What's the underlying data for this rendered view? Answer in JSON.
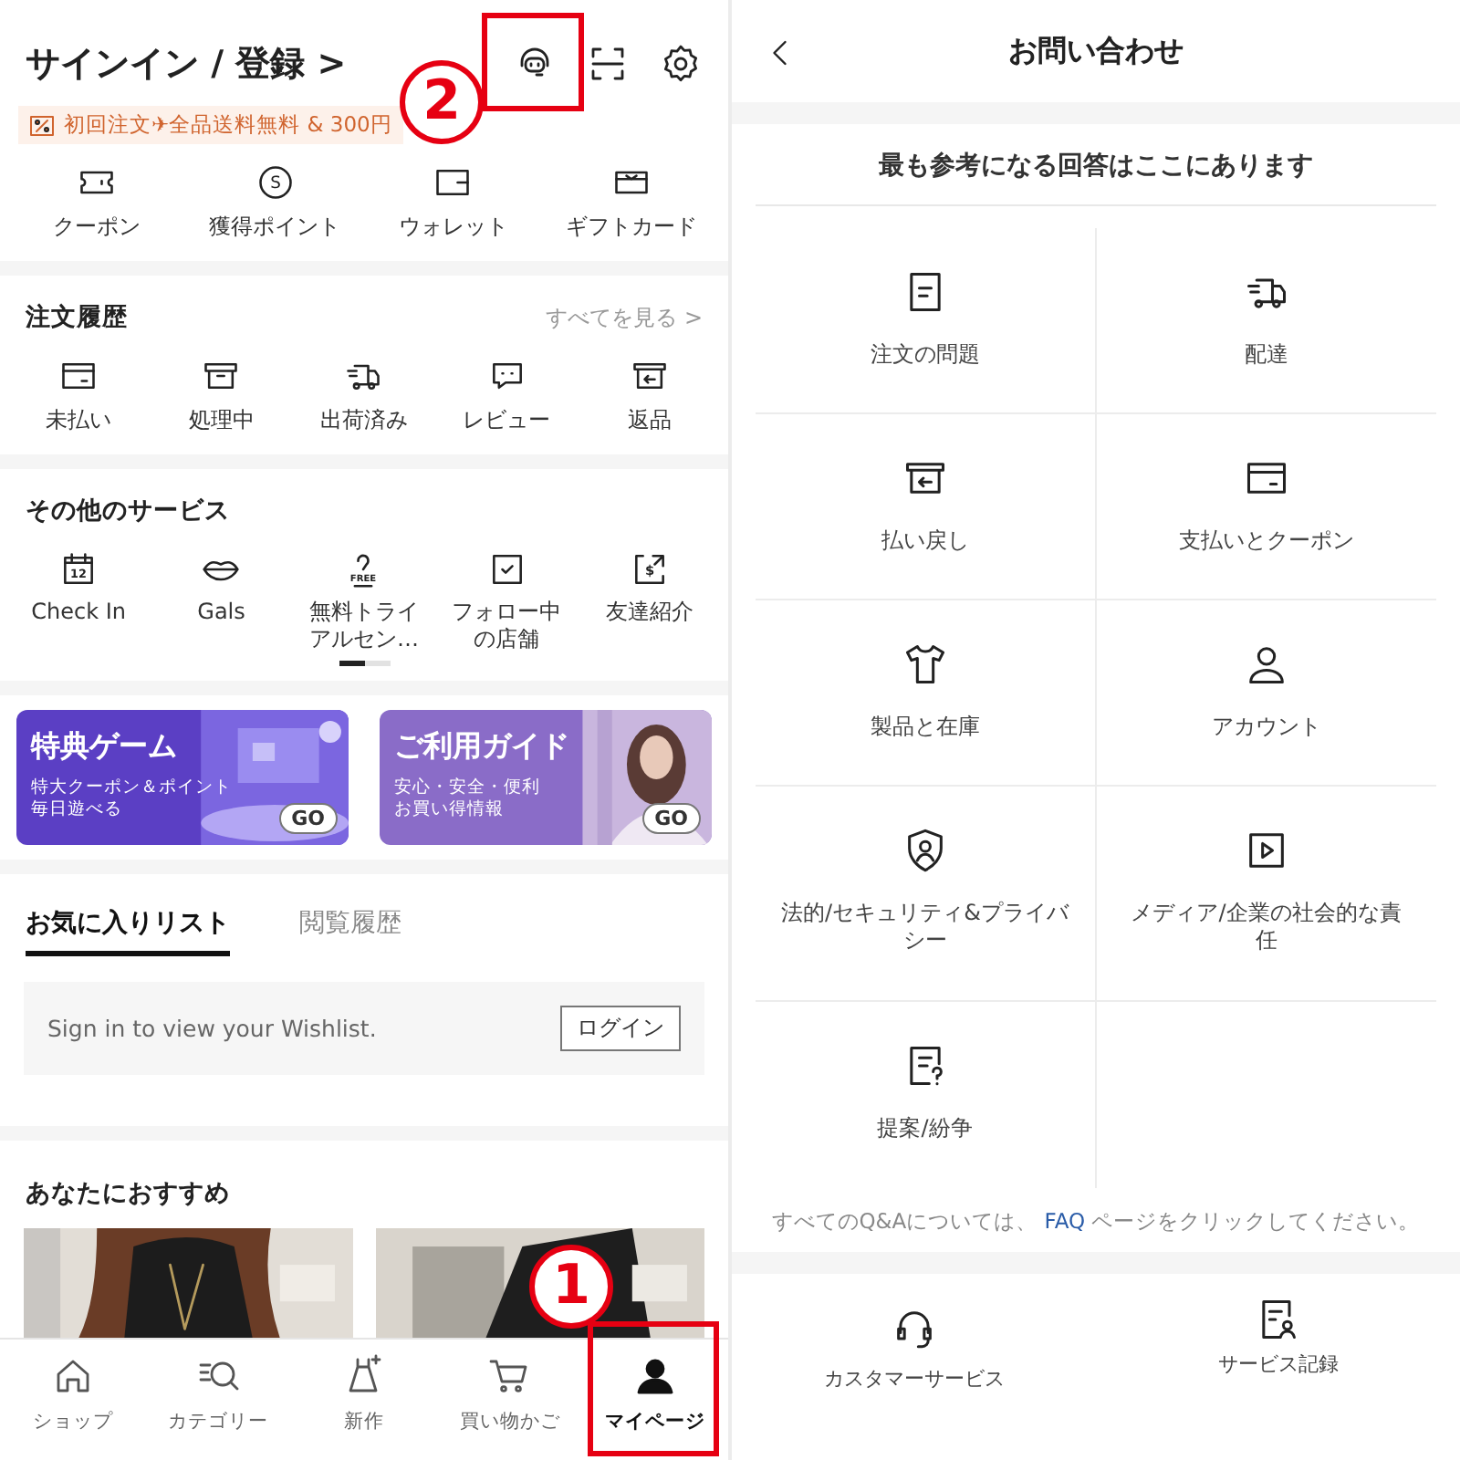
{
  "account": {
    "title": "サインイン / 登録 >",
    "promo": "初回注文✈全品送料無料 & 300円",
    "wallet": [
      {
        "label": "クーポン"
      },
      {
        "label": "獲得ポイント",
        "icon_text": "S"
      },
      {
        "label": "ウォレット"
      },
      {
        "label": "ギフトカード"
      }
    ],
    "orders": {
      "title": "注文履歴",
      "link": "すべてを見る >",
      "items": [
        {
          "label": "未払い"
        },
        {
          "label": "処理中"
        },
        {
          "label": "出荷済み"
        },
        {
          "label": "レビュー"
        },
        {
          "label": "返品"
        }
      ]
    },
    "services": {
      "title": "その他のサービス",
      "items": [
        {
          "label": "Check In",
          "icon_text": "12"
        },
        {
          "label": "Gals"
        },
        {
          "label": "無料トライアルセン…",
          "icon_text": "FREE"
        },
        {
          "label": "フォロー中の店舗"
        },
        {
          "label": "友達紹介",
          "icon_text": "$"
        }
      ],
      "pages": [
        {
          "selected": true
        },
        {
          "selected": false
        }
      ]
    },
    "banners": [
      {
        "title": "特典ゲーム",
        "lines": [
          "特大クーポン＆ポイント",
          "毎日遊べる"
        ],
        "button": "GO"
      },
      {
        "title": "ご利用ガイド",
        "lines": [
          "安心・安全・便利",
          "お買い得情報"
        ],
        "button": "GO"
      }
    ],
    "tabs": [
      {
        "label": "お気に入りリスト",
        "selected": true
      },
      {
        "label": "閲覧履歴",
        "selected": false
      }
    ],
    "wishlist": {
      "message": "Sign in to view your Wishlist.",
      "button": "ログイン"
    },
    "recommend": {
      "title": "あなたにおすすめ"
    },
    "nav": [
      {
        "label": "ショップ",
        "selected": false
      },
      {
        "label": "カテゴリー",
        "selected": false
      },
      {
        "label": "新作",
        "selected": false
      },
      {
        "label": "買い物かご",
        "selected": false
      },
      {
        "label": "マイページ",
        "selected": true
      }
    ]
  },
  "contact": {
    "title": "お問い合わせ",
    "subtitle": "最も参考になる回答はここにあります",
    "topics": [
      {
        "label": "注文の問題"
      },
      {
        "label": "配達"
      },
      {
        "label": "払い戻し"
      },
      {
        "label": "支払いとクーポン"
      },
      {
        "label": "製品と在庫"
      },
      {
        "label": "アカウント"
      },
      {
        "label": "法的/セキュリティ&プライバシー"
      },
      {
        "label": "メディア/企業の社会的な責任"
      },
      {
        "label": "提案/紛争"
      }
    ],
    "faq_note": {
      "before": "すべてのQ&Aについては、",
      "link": "FAQ",
      "after": "ページをクリックしてください。"
    },
    "bottom": [
      {
        "label": "カスタマーサービス"
      },
      {
        "label": "サービス記録"
      }
    ]
  },
  "annotations": [
    {
      "number": "2"
    },
    {
      "number": "1"
    }
  ]
}
